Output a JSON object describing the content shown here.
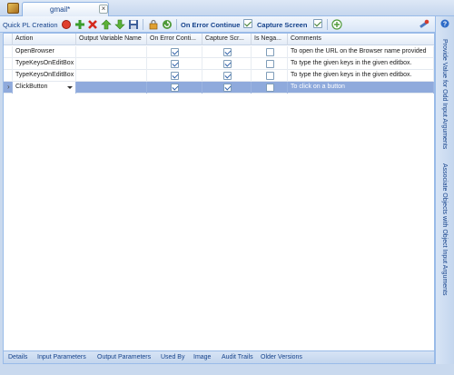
{
  "tab": {
    "title": "gmail*",
    "close": "×"
  },
  "toolbar": {
    "title": "Quick PL Creation",
    "on_error_label": "On Error Continue",
    "capture_label": "Capture Screen",
    "on_error_checked": true,
    "capture_checked": true
  },
  "grid": {
    "columns": [
      "Action",
      "Output Variable Name",
      "On Error Conti...",
      "Capture Scr...",
      "Is Nega...",
      "Comments"
    ],
    "rows": [
      {
        "action": "OpenBrowser",
        "output": "",
        "on_error": true,
        "capture": true,
        "negative": false,
        "comment": "To open the URL on the Browser name provided",
        "selected": false
      },
      {
        "action": "TypeKeysOnEditBox",
        "output": "",
        "on_error": true,
        "capture": true,
        "negative": false,
        "comment": "To type the given keys in the given editbox.",
        "selected": false
      },
      {
        "action": "TypeKeysOnEditBox",
        "output": "",
        "on_error": true,
        "capture": true,
        "negative": false,
        "comment": "To type the given keys in the given editbox.",
        "selected": false
      },
      {
        "action": "ClickButton",
        "output": "",
        "on_error": true,
        "capture": true,
        "negative": false,
        "comment": "To click on a button",
        "selected": true
      }
    ],
    "current_row_marker": "›"
  },
  "bottom_tabs": [
    "Details",
    "Input Parameters",
    "Output Parameters",
    "Used By",
    "Image",
    "Audit Trails",
    "Older Versions"
  ],
  "right_panel": {
    "tabs": [
      "Provide Value for Odd Input Arguments",
      "Associate Objects with Object Input Arguments"
    ]
  },
  "icons": {
    "app": "project-icon",
    "record": "record-icon",
    "add": "add-icon",
    "delete": "delete-icon",
    "up": "move-up-icon",
    "down": "move-down-icon",
    "save": "save-icon",
    "lock": "lock-icon",
    "refresh": "refresh-icon",
    "run": "run-icon",
    "tools": "tools-icon",
    "help": "help-icon"
  },
  "colors": {
    "accent": "#15428b",
    "selection": "#8faadc",
    "border": "#99bbe8"
  }
}
